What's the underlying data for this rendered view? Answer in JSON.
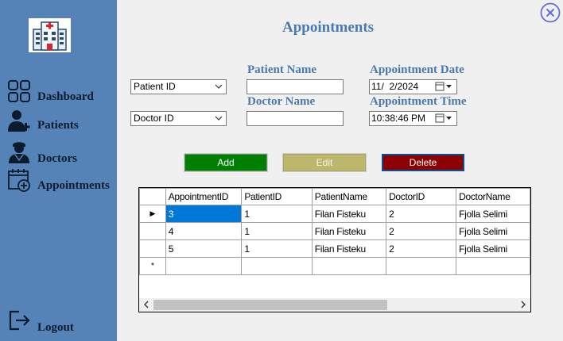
{
  "sidebar": {
    "items": [
      {
        "label": "Dashboard"
      },
      {
        "label": "Patients"
      },
      {
        "label": "Doctors"
      },
      {
        "label": "Appointments"
      }
    ],
    "logout_label": "Logout"
  },
  "main": {
    "title": "Appointments",
    "form": {
      "patient_id_select": "Patient ID",
      "doctor_id_select": "Doctor ID",
      "patient_name_label": "Patient Name",
      "patient_name_value": "",
      "doctor_name_label": "Doctor Name",
      "doctor_name_value": "",
      "appointment_date_label": "Appointment Date",
      "appointment_date_value": "11/  2/2024",
      "appointment_time_label": "Appointment Time",
      "appointment_time_value": "10:38:46 PM"
    },
    "buttons": {
      "add": "Add",
      "edit": "Edit",
      "delete": "Delete"
    },
    "grid": {
      "columns": [
        "AppointmentID",
        "PatientID",
        "PatientName",
        "DoctorID",
        "DoctorName"
      ],
      "rows": [
        [
          "3",
          "1",
          "Filan Fisteku",
          "2",
          "Fjolla Selimi"
        ],
        [
          "4",
          "1",
          "Filan Fisteku",
          "2",
          "Fjolla Selimi"
        ],
        [
          "5",
          "1",
          "Filan Fisteku",
          "2",
          "Fjolla Selimi"
        ]
      ],
      "new_row_marker": "*",
      "current_row_marker": "▶"
    }
  },
  "colors": {
    "sidebar": "#5583b8",
    "heading": "#4a79ad",
    "add": "#008000",
    "edit": "#bdb76b",
    "delete": "#8b0000",
    "selection": "#0078d7"
  },
  "icons": [
    "hospital-logo-icon",
    "dashboard-icon",
    "patient-icon",
    "doctor-icon",
    "calendar-icon",
    "logout-icon",
    "close-icon"
  ]
}
